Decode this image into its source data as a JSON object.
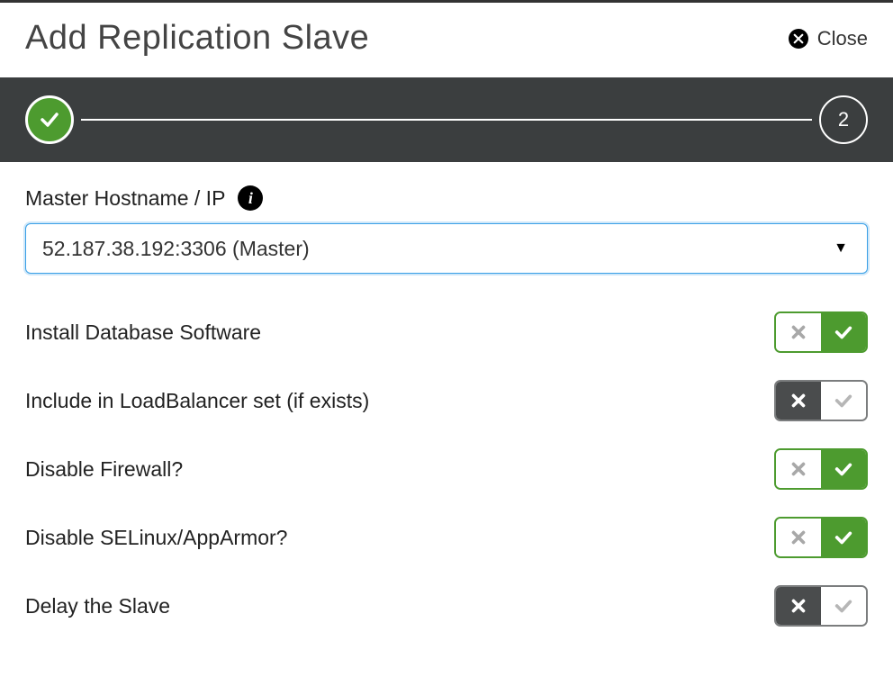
{
  "header": {
    "title": "Add Replication Slave",
    "close_label": "Close"
  },
  "stepper": {
    "step2_label": "2"
  },
  "fields": {
    "master_label": "Master Hostname / IP",
    "master_value": "52.187.38.192:3306 (Master)"
  },
  "options": {
    "install_db": {
      "label": "Install Database Software",
      "value": true
    },
    "include_lb": {
      "label": "Include in LoadBalancer set (if exists)",
      "value": false
    },
    "disable_firewall": {
      "label": "Disable Firewall?",
      "value": true
    },
    "disable_selinux": {
      "label": "Disable SELinux/AppArmor?",
      "value": true
    },
    "delay_slave": {
      "label": "Delay the Slave",
      "value": false
    }
  }
}
